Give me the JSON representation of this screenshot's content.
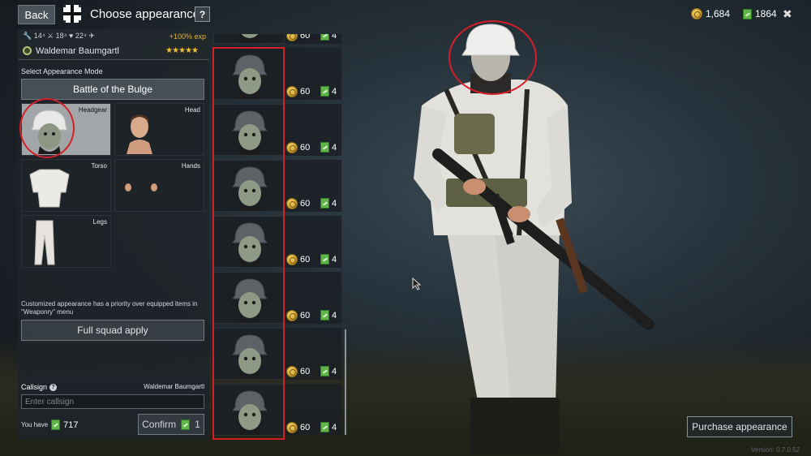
{
  "topbar": {
    "back_label": "Back",
    "title": "Choose appearance",
    "help_label": "?",
    "gold": "1,684",
    "tickets": "1864",
    "close_label": "✖"
  },
  "soldier": {
    "stats": "🔧 14⁴ ⚔ 18⁴ ♥ 22⁴ ✈",
    "exp_bonus": "+100% exp",
    "name": "Waldemar Baumgartl",
    "stars": "★★★★★"
  },
  "appearance_mode": {
    "label": "Select Appearance Mode",
    "selected": "Battle of the Bulge"
  },
  "slots": [
    {
      "label": "Headgear"
    },
    {
      "label": "Head"
    },
    {
      "label": "Torso"
    },
    {
      "label": "Hands"
    },
    {
      "label": "Legs"
    }
  ],
  "notice": "Customized appearance has a priority over equipped items in \"Weaponry\" menu",
  "full_squad_label": "Full squad apply",
  "callsign": {
    "label": "Callsign",
    "help": "?",
    "soldier_name": "Waldemar Baumgartl",
    "placeholder": "Enter callsign",
    "you_have_label": "You have",
    "you_have_amount": "717",
    "confirm_label": "Confirm",
    "confirm_cost": "1"
  },
  "items": [
    {
      "gold": "60",
      "tickets": "4"
    },
    {
      "gold": "60",
      "tickets": "4"
    },
    {
      "gold": "60",
      "tickets": "4"
    },
    {
      "gold": "60",
      "tickets": "4"
    },
    {
      "gold": "60",
      "tickets": "4"
    },
    {
      "gold": "60",
      "tickets": "4"
    },
    {
      "gold": "60",
      "tickets": "4"
    },
    {
      "gold": "60",
      "tickets": "4"
    }
  ],
  "purchase_label": "Purchase appearance",
  "version": "Version: 0.7.0.52",
  "colors": {
    "highlight_red": "#d41f28",
    "gold": "#e5b23c",
    "ticket_green": "#5fb548"
  }
}
